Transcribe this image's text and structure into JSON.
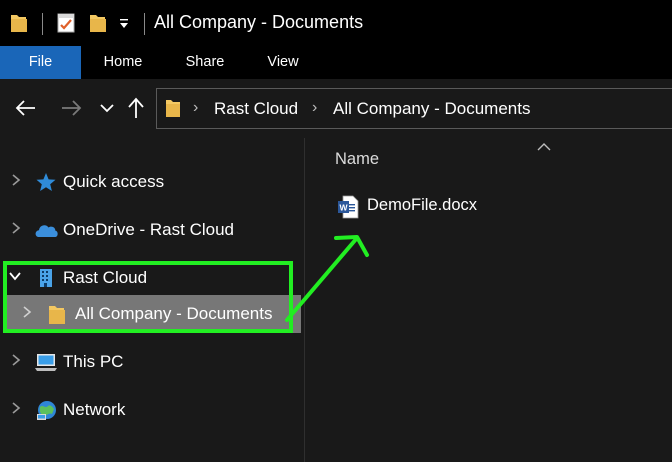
{
  "window": {
    "title": "All Company - Documents"
  },
  "ribbon": {
    "tabs": [
      {
        "label": "File"
      },
      {
        "label": "Home"
      },
      {
        "label": "Share"
      },
      {
        "label": "View"
      }
    ]
  },
  "address": {
    "breadcrumbs": [
      "Rast Cloud",
      "All Company - Documents"
    ]
  },
  "nav_pane": {
    "items": [
      {
        "label": "Quick access",
        "icon": "star-icon",
        "expanded": false,
        "selected": false
      },
      {
        "label": "OneDrive - Rast Cloud",
        "icon": "cloud-icon",
        "expanded": false,
        "selected": false
      },
      {
        "label": "Rast Cloud",
        "icon": "building-icon",
        "expanded": true,
        "selected": false
      },
      {
        "label": "All Company - Documents",
        "icon": "folder-icon",
        "expanded": false,
        "selected": true
      },
      {
        "label": "This PC",
        "icon": "computer-icon",
        "expanded": false,
        "selected": false
      },
      {
        "label": "Network",
        "icon": "network-icon",
        "expanded": false,
        "selected": false
      }
    ]
  },
  "content": {
    "column_header": "Name",
    "files": [
      {
        "name": "DemoFile.docx",
        "icon": "word-document-icon"
      }
    ]
  },
  "colors": {
    "background": "#191919",
    "titlebar": "#000000",
    "file_tab": "#1a66b8",
    "selected_item": "#777777",
    "annotation": "#22ee22",
    "folder": "#f3c862",
    "star": "#2f8bd8",
    "word_blue": "#2b579a"
  }
}
